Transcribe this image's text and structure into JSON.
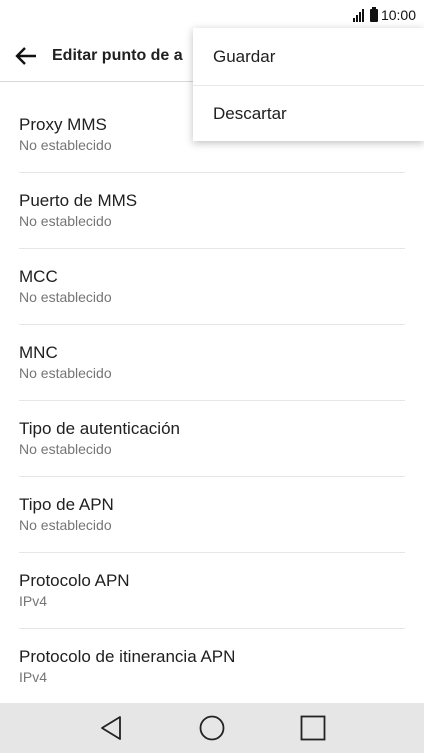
{
  "status_bar": {
    "time": "10:00",
    "icons": [
      "signal-icon",
      "battery-icon"
    ]
  },
  "app_bar": {
    "back_icon": "arrow-left-icon",
    "title": "Editar punto de a"
  },
  "menu": {
    "items": [
      {
        "label": "Guardar"
      },
      {
        "label": "Descartar"
      }
    ]
  },
  "list": {
    "items": [
      {
        "title": "Proxy MMS",
        "value": "No establecido"
      },
      {
        "title": "Puerto de MMS",
        "value": "No establecido"
      },
      {
        "title": "MCC",
        "value": "No establecido"
      },
      {
        "title": "MNC",
        "value": "No establecido"
      },
      {
        "title": "Tipo de autenticación",
        "value": "No establecido"
      },
      {
        "title": "Tipo de APN",
        "value": "No establecido"
      },
      {
        "title": "Protocolo APN",
        "value": "IPv4"
      },
      {
        "title": "Protocolo de itinerancia APN",
        "value": "IPv4"
      }
    ]
  },
  "nav_bar": {
    "icons": [
      "back-triangle-icon",
      "home-circle-icon",
      "recents-square-icon"
    ]
  }
}
